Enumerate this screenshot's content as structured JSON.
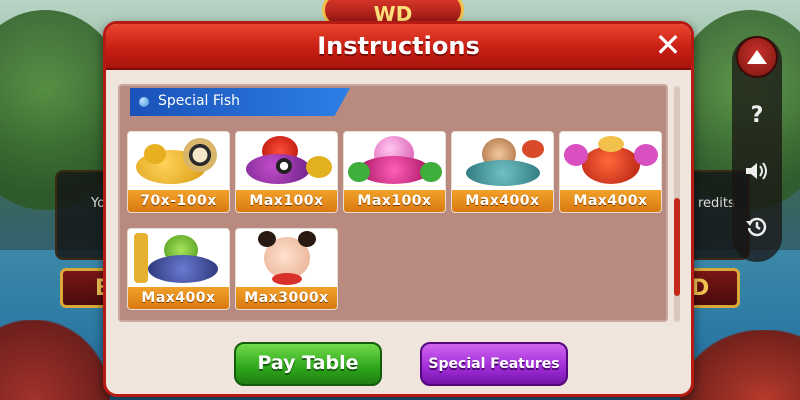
{
  "logo": {
    "text": "WD"
  },
  "background": {
    "plaque_left_text": "Yo",
    "plaque_right_text": "redits",
    "sign_left_text": "B",
    "sign_right_text": "D"
  },
  "dialog": {
    "title": "Instructions",
    "close_label": "✕",
    "section_label": "Special Fish"
  },
  "fish_cards": [
    {
      "icon": "golden-toad-icon",
      "multiplier": "70x-100x"
    },
    {
      "icon": "fish-lantern-icon",
      "multiplier": "Max100x"
    },
    {
      "icon": "lotus-jewel-icon",
      "multiplier": "Max100x"
    },
    {
      "icon": "monkey-king-icon",
      "multiplier": "Max400x"
    },
    {
      "icon": "crab-king-icon",
      "multiplier": "Max400x"
    },
    {
      "icon": "turtle-general-icon",
      "multiplier": "Max400x"
    },
    {
      "icon": "nezha-child-icon",
      "multiplier": "Max3000x"
    }
  ],
  "buttons": {
    "pay_table": "Pay Table",
    "special_features": "Special Features"
  },
  "side_buttons": [
    {
      "icon": "arrow-up-icon"
    },
    {
      "icon": "help-icon",
      "glyph": "?"
    },
    {
      "icon": "volume-icon"
    },
    {
      "icon": "history-icon"
    }
  ],
  "colors": {
    "header_red": "#c91f14",
    "content_bg": "#b98a7f",
    "multiplier_orange": "#e98e1a",
    "pay_button_green": "#2fa51c",
    "special_button_purple": "#9f2cd6",
    "section_tab_blue": "#2d7fe6"
  }
}
